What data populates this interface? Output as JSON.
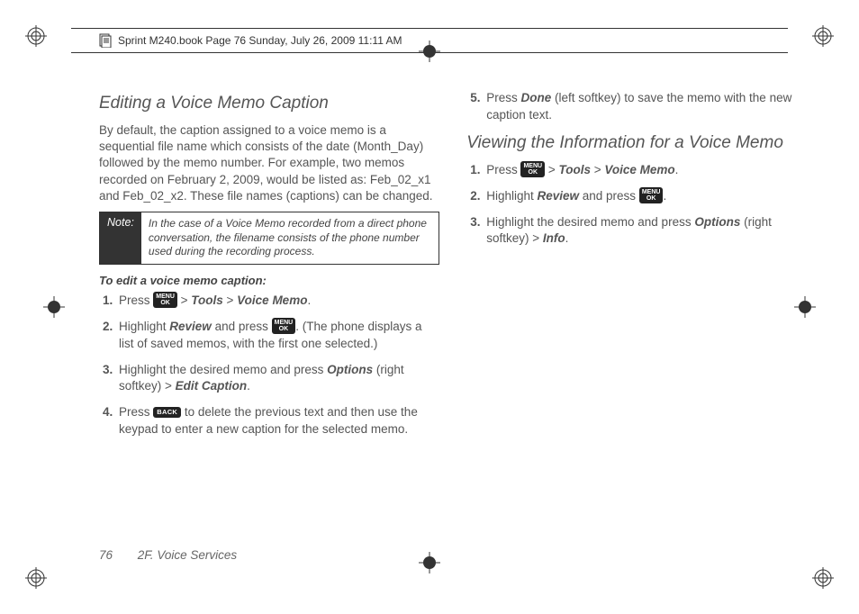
{
  "header": {
    "text": "Sprint M240.book  Page 76  Sunday, July 26, 2009  11:11 AM"
  },
  "col_left": {
    "heading": "Editing a Voice Memo Caption",
    "intro": "By default, the caption assigned to a voice memo is a sequential file name which consists of the date (Month_Day) followed by the memo number. For example, two memos recorded on February 2, 2009, would be listed as: Feb_02_x1 and Feb_02_x2. These file names (captions) can be changed.",
    "note_label": "Note:",
    "note_text": "In the case of a Voice Memo recorded from a direct phone conversation, the filename consists of the phone number used during the recording process.",
    "sub": "To edit a voice memo caption:",
    "steps": {
      "0": {
        "n": "1.",
        "a": "Press ",
        "b": " > ",
        "tools": "Tools",
        "c": " > ",
        "vm": "Voice Memo",
        "d": "."
      },
      "1": {
        "n": "2.",
        "a": "Highlight ",
        "rev": "Review",
        "b": " and press ",
        "c": ". (The phone displays a list of saved memos, with the first one selected.)"
      },
      "2": {
        "n": "3.",
        "a": "Highlight the desired memo and press ",
        "opt": "Options",
        "b": " (right softkey) ",
        "c": "> ",
        "ec": "Edit Caption",
        "d": "."
      },
      "3": {
        "n": "4.",
        "a": "Press ",
        "b": " to delete the previous text and then use the keypad to enter a new caption for the selected memo."
      }
    }
  },
  "col_right": {
    "step5": {
      "n": "5.",
      "a": "Press ",
      "done": "Done",
      "b": " (left softkey) to save the memo with the new caption text."
    },
    "heading": "Viewing the Information for a Voice Memo",
    "steps": {
      "0": {
        "n": "1.",
        "a": "Press ",
        "b": " > ",
        "tools": "Tools",
        "c": " > ",
        "vm": "Voice Memo",
        "d": "."
      },
      "1": {
        "n": "2.",
        "a": "Highlight ",
        "rev": "Review",
        "b": " and press ",
        "c": "."
      },
      "2": {
        "n": "3.",
        "a": "Highlight the desired memo and press ",
        "opt": "Options",
        "b": " (right softkey) ",
        "c": "> ",
        "info": "Info",
        "d": "."
      }
    }
  },
  "footer": {
    "page": "76",
    "section": "2F. Voice Services"
  },
  "keys": {
    "menu": "MENU\nOK",
    "back": "BACK"
  }
}
